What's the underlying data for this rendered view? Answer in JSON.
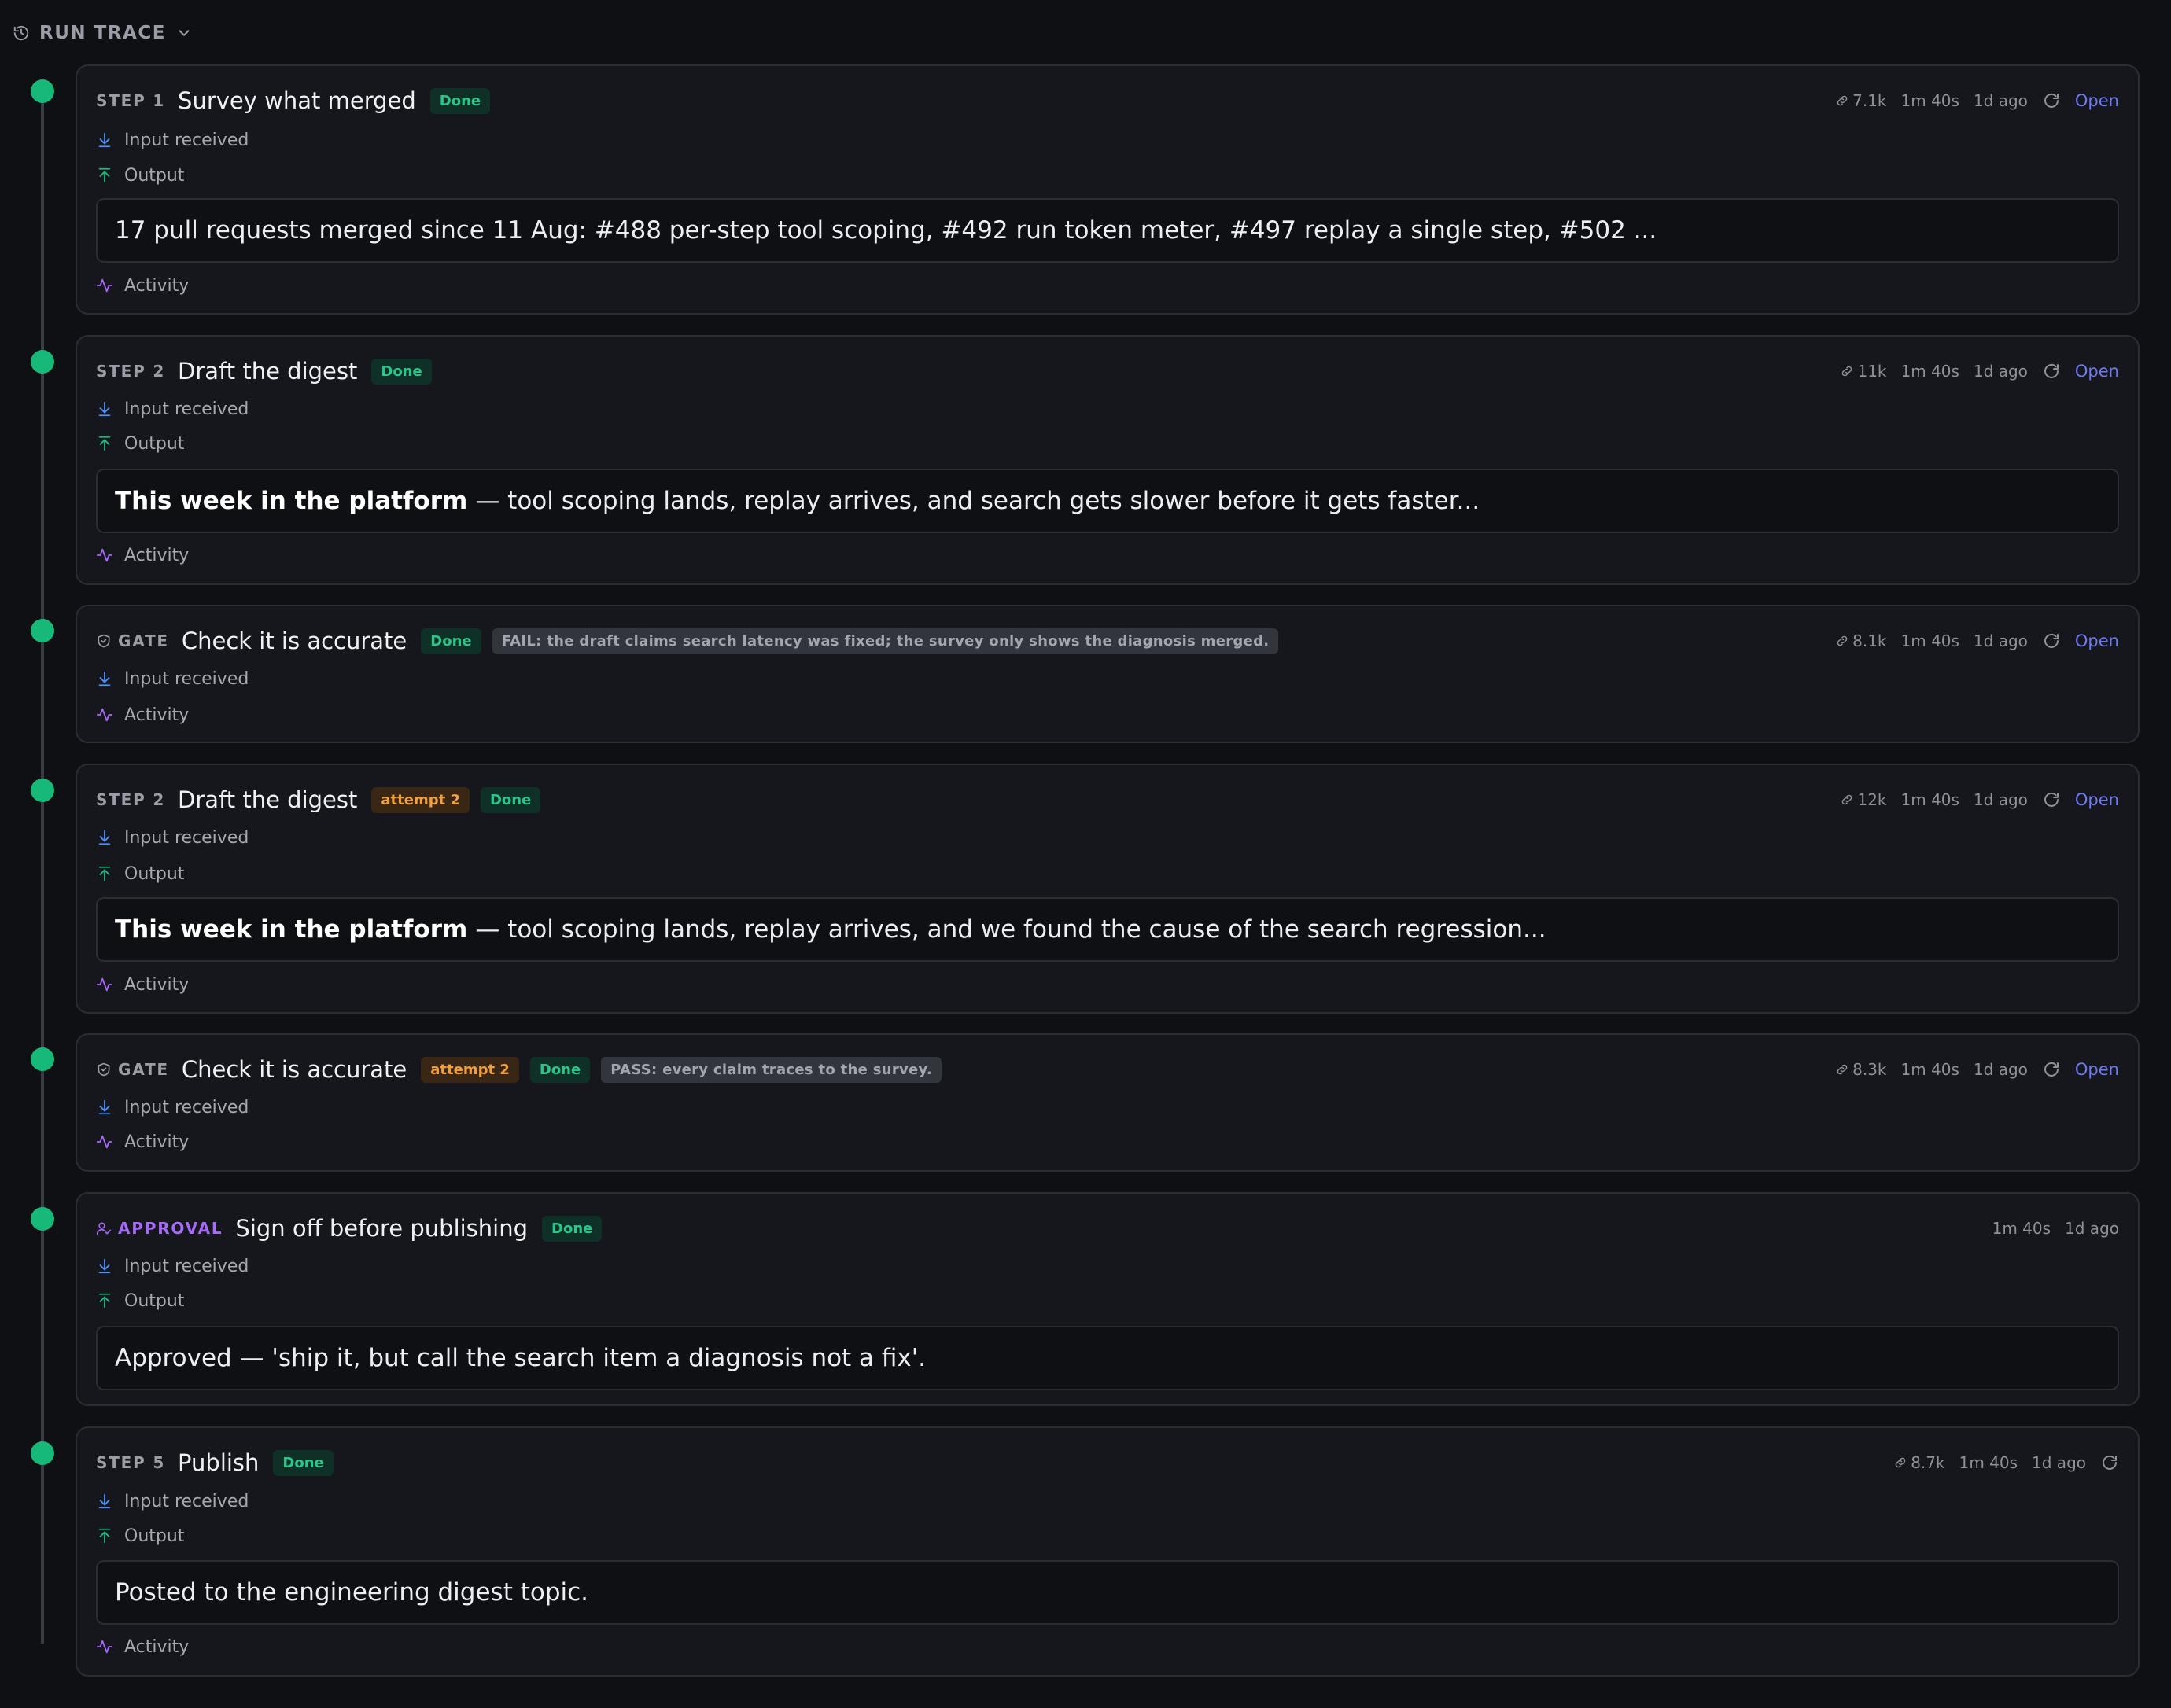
{
  "header": {
    "title": "RUN TRACE"
  },
  "labels": {
    "input": "Input received",
    "output": "Output",
    "activity": "Activity"
  },
  "colors": {
    "done_dot": "#17b978",
    "input_icon": "#4d8ef7",
    "output_icon": "#27b57f",
    "activity_icon": "#a56af6",
    "open_link": "#6d79f0"
  },
  "steps": [
    {
      "kind": "STEP 1",
      "title": "Survey what merged",
      "status": "Done",
      "tokens": "7.1k",
      "duration": "1m 40s",
      "ago": "1d ago",
      "open": "Open",
      "output_bold": "",
      "output": "17 pull requests merged since 11 Aug: #488 per-step tool scoping, #492 run token meter, #497 replay a single step, #502 ..."
    },
    {
      "kind": "STEP 2",
      "title": "Draft the digest",
      "status": "Done",
      "tokens": "11k",
      "duration": "1m 40s",
      "ago": "1d ago",
      "open": "Open",
      "output_bold": "This week in the platform",
      "output": "— tool scoping lands, replay arrives, and search gets slower before it gets faster..."
    },
    {
      "kind": "GATE",
      "title": "Check it is accurate",
      "status": "Done",
      "note": "FAIL: the draft claims search latency was fixed; the survey only shows the diagnosis merged.",
      "tokens": "8.1k",
      "duration": "1m 40s",
      "ago": "1d ago",
      "open": "Open"
    },
    {
      "kind": "STEP 2",
      "title": "Draft the digest",
      "attempt": "attempt 2",
      "status": "Done",
      "tokens": "12k",
      "duration": "1m 40s",
      "ago": "1d ago",
      "open": "Open",
      "output_bold": "This week in the platform",
      "output": "— tool scoping lands, replay arrives, and we found the cause of the search regression..."
    },
    {
      "kind": "GATE",
      "title": "Check it is accurate",
      "attempt": "attempt 2",
      "status": "Done",
      "note": "PASS: every claim traces to the survey.",
      "tokens": "8.3k",
      "duration": "1m 40s",
      "ago": "1d ago",
      "open": "Open"
    },
    {
      "kind": "APPROVAL",
      "title": "Sign off before publishing",
      "status": "Done",
      "duration": "1m 40s",
      "ago": "1d ago",
      "output_bold": "",
      "output": "Approved — 'ship it, but call the search item a diagnosis not a fix'."
    },
    {
      "kind": "STEP 5",
      "title": "Publish",
      "status": "Done",
      "tokens": "8.7k",
      "duration": "1m 40s",
      "ago": "1d ago",
      "output_bold": "",
      "output": "Posted to the engineering digest topic."
    }
  ]
}
